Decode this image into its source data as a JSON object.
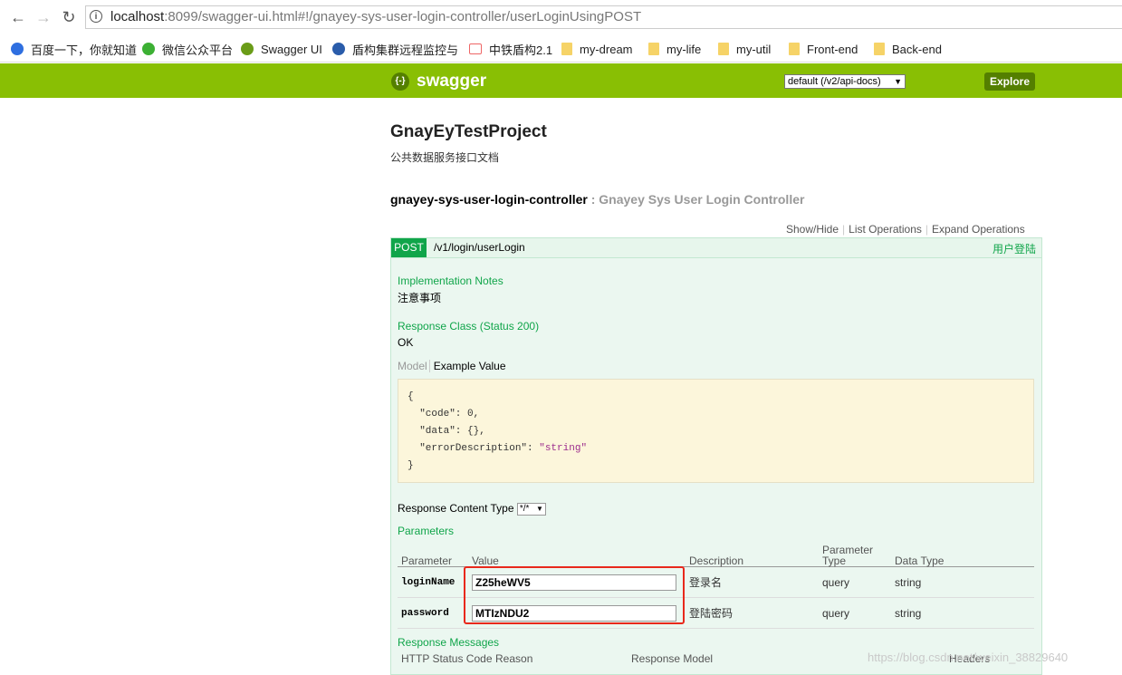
{
  "browser": {
    "url_host": "localhost",
    "url_rest": ":8099/swagger-ui.html#!/gnayey-sys-user-login-controller/userLoginUsingPOST",
    "bookmarks": [
      "百度一下，你就知道",
      "微信公众平台",
      "Swagger UI",
      "盾构集群远程监控与",
      "中铁盾构2.1",
      "my-dream",
      "my-life",
      "my-util",
      "Front-end",
      "Back-end"
    ]
  },
  "swagger": {
    "brand": "swagger",
    "spec_select": "default (/v2/api-docs)",
    "explore_label": "Explore"
  },
  "project": {
    "title": "GnayEyTestProject",
    "description": "公共数据服务接口文档"
  },
  "controller": {
    "name": "gnayey-sys-user-login-controller",
    "subtitle": " : Gnayey Sys User Login Controller",
    "show_hide": "Show/Hide",
    "list_ops": "List Operations",
    "expand_ops": "Expand Operations"
  },
  "operation": {
    "method": "POST",
    "path": "/v1/login/userLogin",
    "summary": "用户登陆",
    "impl_notes_label": "Implementation Notes",
    "impl_notes": "注意事项",
    "response_class_label": "Response Class (Status 200)",
    "response_class": "OK",
    "tab_model": "Model",
    "tab_example": "Example Value",
    "example_lines": [
      "{",
      "  \"code\": 0,",
      "  \"data\": {},",
      "  \"errorDescription\": ",
      "}"
    ],
    "example_string": "\"string\"",
    "response_content_type_label": "Response Content Type",
    "response_content_type": "*/*",
    "parameters_label": "Parameters",
    "param_headers": [
      "Parameter",
      "Value",
      "Description",
      "Parameter Type",
      "Data Type"
    ],
    "params": [
      {
        "name": "loginName",
        "value": "Z25heWV5",
        "description": "登录名",
        "type": "query",
        "data_type": "string"
      },
      {
        "name": "password",
        "value": "MTIzNDU2",
        "description": "登陆密码",
        "type": "query",
        "data_type": "string"
      }
    ],
    "response_messages_label": "Response Messages",
    "response_headers": [
      "HTTP Status Code",
      "Reason",
      "Response Model",
      "Headers"
    ]
  },
  "watermark": "https://blog.csdn.net/weixin_38829640"
}
